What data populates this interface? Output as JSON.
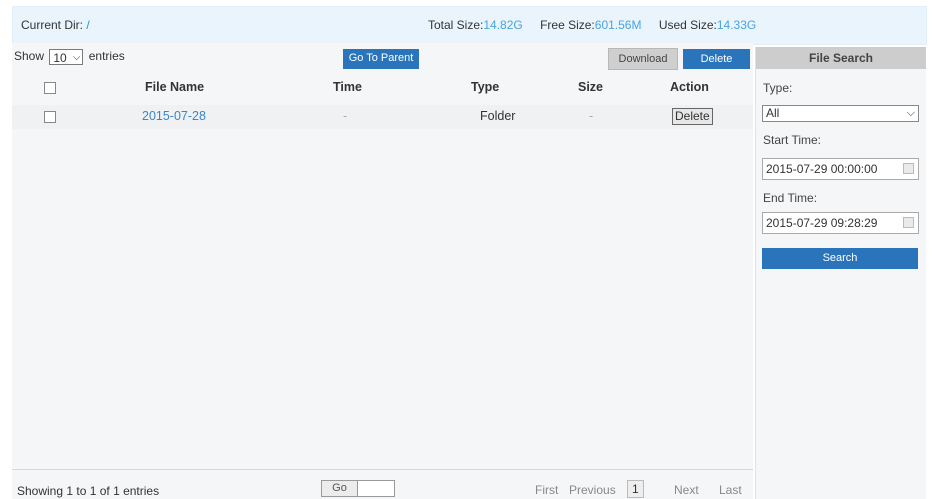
{
  "topbar": {
    "current_dir_label": "Current Dir:",
    "current_dir_value": "/",
    "total_label": "Total Size:",
    "total_value": "14.82G",
    "free_label": "Free Size:",
    "free_value": "601.56M",
    "used_label": "Used Size:",
    "used_value": "14.33G"
  },
  "controls": {
    "show_label": "Show",
    "entries_value": "10",
    "entries_label": "entries",
    "go_to_parent": "Go To Parent",
    "download": "Download",
    "delete": "Delete"
  },
  "table": {
    "headers": [
      "File Name",
      "Time",
      "Type",
      "Size",
      "Action"
    ],
    "rows": [
      {
        "name": "2015-07-28",
        "time": "-",
        "type": "Folder",
        "size": "-",
        "action": "Delete"
      }
    ]
  },
  "footer": {
    "showing": "Showing 1 to 1 of 1 entries",
    "go": "Go",
    "first": "First",
    "previous": "Previous",
    "page": "1",
    "next": "Next",
    "last": "Last"
  },
  "search": {
    "title": "File Search",
    "type_label": "Type:",
    "type_value": "All",
    "start_label": "Start Time:",
    "start_value": "2015-07-29 00:00:00",
    "end_label": "End Time:",
    "end_value": "2015-07-29 09:28:29",
    "button": "Search"
  },
  "colors": {
    "accent_blue": "#2a74bb",
    "link_blue": "#3b86c8",
    "header_bg": "#e9f4fc"
  }
}
